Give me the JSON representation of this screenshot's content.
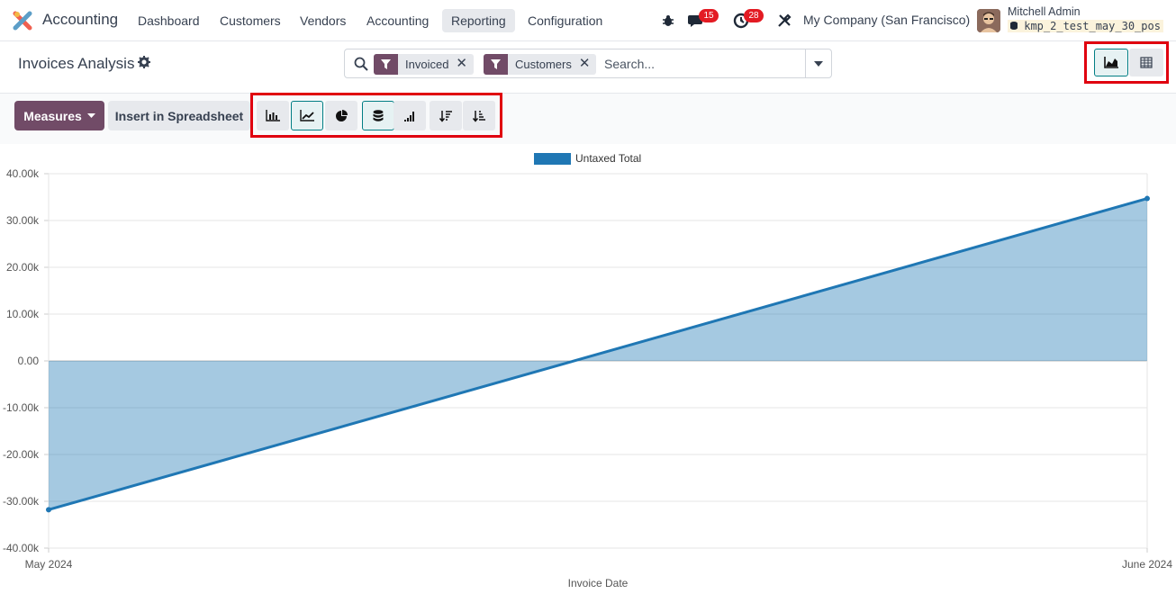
{
  "navbar": {
    "app_name": "Accounting",
    "menu": [
      "Dashboard",
      "Customers",
      "Vendors",
      "Accounting",
      "Reporting",
      "Configuration"
    ],
    "active_menu": "Reporting",
    "messages_count": "15",
    "activities_count": "28",
    "company": "My Company (San Francisco)",
    "user_name": "Mitchell Admin",
    "database": "kmp_2_test_may_30_pos"
  },
  "control_panel": {
    "title": "Invoices Analysis",
    "search": {
      "facets": [
        "Invoiced",
        "Customers"
      ],
      "placeholder": "Search..."
    },
    "views": {
      "active": "graph",
      "items": [
        "graph",
        "pivot"
      ]
    }
  },
  "toolbar": {
    "measures_label": "Measures",
    "insert_label": "Insert in Spreadsheet",
    "chart_types": [
      "bar",
      "line",
      "pie"
    ],
    "active_chart_type": "line",
    "stacked_active": true
  },
  "chart_data": {
    "type": "area",
    "x": [
      "May 2024",
      "June 2024"
    ],
    "series": [
      {
        "name": "Untaxed Total",
        "values": [
          -31800,
          34700
        ],
        "color": "#1f77b4"
      }
    ],
    "xlabel": "Invoice Date",
    "ylabel": "",
    "ylim": [
      -40000,
      40000
    ],
    "yticks": [
      "-40.00k",
      "-30.00k",
      "-20.00k",
      "-10.00k",
      "0.00",
      "10.00k",
      "20.00k",
      "30.00k",
      "40.00k"
    ],
    "grid": true,
    "legend": "top-center"
  }
}
